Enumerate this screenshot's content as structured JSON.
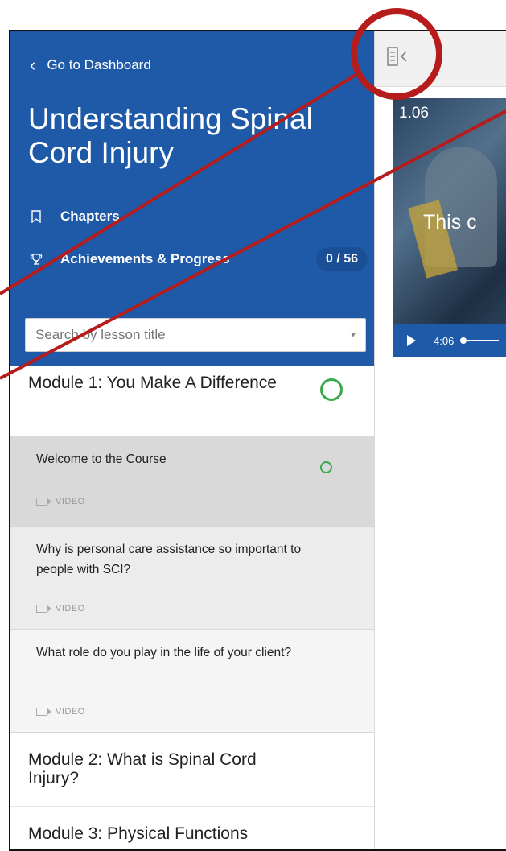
{
  "sidebar": {
    "back_label": "Go to Dashboard",
    "course_title": "Understanding Spinal Cord Injury",
    "chapters_label": "Chapters",
    "achievements_label": "Achievements & Progress",
    "progress_badge": "0 / 56",
    "search_placeholder": "Search by lesson title"
  },
  "modules": [
    {
      "title": "Module 1: You Make A Difference",
      "lessons": [
        {
          "title": "Welcome to the Course",
          "type": "VIDEO"
        },
        {
          "title": "Why is personal care assistance so important to people with SCI?",
          "type": "VIDEO"
        },
        {
          "title": "What role do you play in the life of your client?",
          "type": "VIDEO"
        }
      ]
    },
    {
      "title": "Module 2: What is Spinal Cord Injury?"
    },
    {
      "title": "Module 3: Physical Functions"
    }
  ],
  "video": {
    "timestamp_label": "1.06",
    "caption_visible": "This c",
    "time": "4:06"
  },
  "icons": {
    "back": "chevron-left-icon",
    "chapters": "bookmark-icon",
    "achievements": "trophy-icon",
    "sidebar_toggle": "collapse-sidebar-icon",
    "lesson_type": "video-camera-icon",
    "status": "progress-ring-icon"
  },
  "colors": {
    "header_blue": "#1f5aa8",
    "complete_green": "#3aa84d",
    "annotation_red": "#b71c1c"
  }
}
